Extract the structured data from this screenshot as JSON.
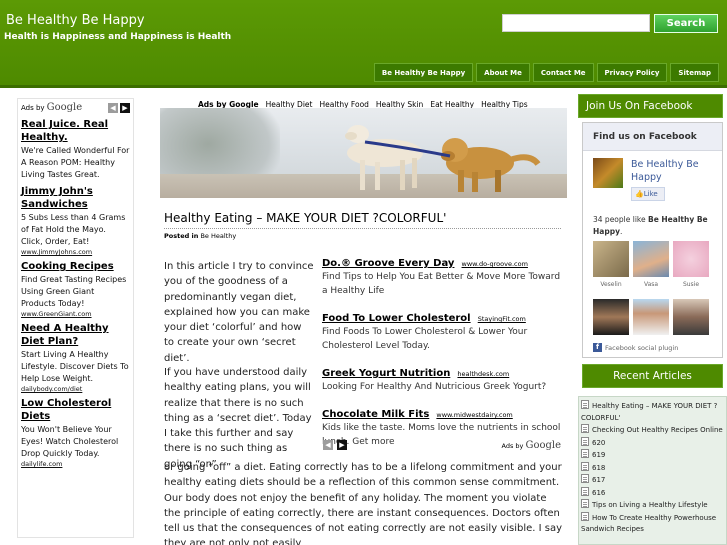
{
  "header": {
    "site_title": "Be Healthy Be Happy",
    "tagline": "Health is Happiness and Happiness is Health",
    "search_button": "Search",
    "search_value": "",
    "nav": [
      "Be Healthy Be Happy",
      "About Me",
      "Contact Me",
      "Privacy Policy",
      "Sitemap"
    ]
  },
  "left_ads": {
    "ads_by": "Ads by",
    "google": "Google",
    "items": [
      {
        "title": "Real Juice. Real Healthy.",
        "body": "We're Called Wonderful For A Reason POM: Healthy Living Tastes Great.",
        "url": ""
      },
      {
        "title": "Jimmy John's Sandwiches",
        "body": "5 Subs Less than 4 Grams of Fat Hold the Mayo. Click, Order, Eat!",
        "url": "www.JimmyJohns.com"
      },
      {
        "title": "Cooking Recipes",
        "body": "Find Great Tasting Recipes Using Green Giant Products Today!",
        "url": "www.GreenGiant.com"
      },
      {
        "title": "Need A Healthy Diet Plan?",
        "body": "Start Living A Healthy Lifestyle. Discover Diets To Help Lose Weight.",
        "url": "dailybody.com/diet"
      },
      {
        "title": "Low Cholesterol Diets",
        "body": "You Won't Believe Your Eyes! Watch Cholesterol Drop Quickly Today.",
        "url": "dailylife.com"
      }
    ]
  },
  "top_links": {
    "ads_label": "Ads by Google",
    "links": [
      "Healthy Diet",
      "Healthy Food",
      "Healthy Skin",
      "Eat Healthy",
      "Healthy Tips"
    ]
  },
  "post": {
    "title": "Healthy Eating – MAKE YOUR DIET ?COLORFUL'",
    "posted_in_label": "Posted in",
    "category": "Be Healthy",
    "intro": "In this article I try to convince you of the goodness of a predominantly vegan diet, explained how you can make your diet ‘colorful’ and how to create your own ‘secret diet’.",
    "para2": "If you have understood daily healthy eating plans, you will realize that there is no such thing as a ‘secret diet’. Today I take this further and say there is no such thing as going “on”",
    "para3": "or going “off” a diet. Eating correctly has to be a lifelong commitment and your healthy eating diets should be a reflection of this common sense commitment. Our body does not enjoy the benefit of any holiday. The moment you violate the principle of eating correctly, there are instant consequences. Doctors often tell us that the consequences of not eating correctly are not easily visible. I say they are not only not easily"
  },
  "inline_ads": {
    "items": [
      {
        "title": "Do.® Groove Every Day",
        "url": "www.do-groove.com",
        "body": "Find Tips to Help You Eat Better & Move More Toward a Healthy Life"
      },
      {
        "title": "Food To Lower Cholesterol",
        "url": "StayingFit.com",
        "body": "Find Foods To Lower Cholesterol & Lower Your Cholesterol Level Today."
      },
      {
        "title": "Greek Yogurt Nutrition",
        "url": "healthdesk.com",
        "body": "Looking For Healthy And Nutricious Greek Yogurt?"
      },
      {
        "title": "Chocolate Milk Fits",
        "url": "www.midwestdairy.com",
        "body": "Kids like the taste. Moms love the nutrients in school lunch. Get more"
      }
    ],
    "ads_by": "Ads by",
    "google": "Google"
  },
  "facebook": {
    "header": "Join Us On Facebook",
    "box_title": "Find us on Facebook",
    "page_name": "Be Healthy Be Happy",
    "like_label": "Like",
    "count_text": "34 people like",
    "count_page": "Be Healthy Be Happy",
    "friends": [
      "Veselin",
      "Vasa",
      "Susie",
      "",
      "",
      ""
    ],
    "plugin_label": "Facebook social plugin"
  },
  "recent": {
    "header": "Recent Articles",
    "items": [
      "Healthy Eating – MAKE YOUR DIET ?COLORFUL'",
      "Checking Out Healthy Recipes Online",
      "620",
      "619",
      "618",
      "617",
      "616",
      "Tips on Living a Healthy Lifestyle",
      "How To Create Healthy Powerhouse Sandwich Recipes"
    ]
  }
}
